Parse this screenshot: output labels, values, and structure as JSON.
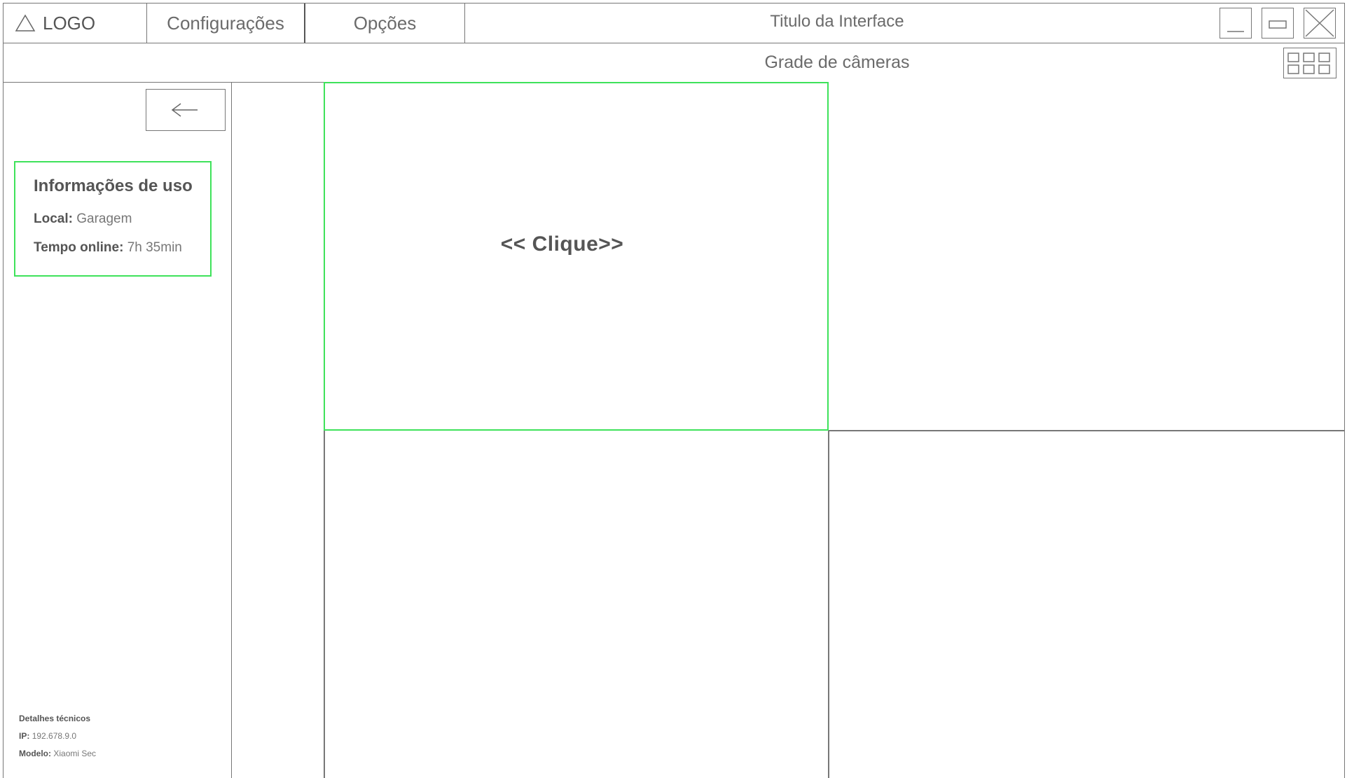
{
  "header": {
    "logo_text": "LOGO",
    "menu": [
      {
        "label": "Configurações"
      },
      {
        "label": "Opções"
      }
    ],
    "window_title": "Titulo da Interface"
  },
  "subheader": {
    "title": "Grade de câmeras"
  },
  "sidebar": {
    "back_label": "<—",
    "info": {
      "title": "Informações de uso",
      "local_label": "Local:",
      "local_value": "Garagem",
      "tempo_label": "Tempo online:",
      "tempo_value": "7h 35min"
    },
    "tech": {
      "title": "Detalhes técnicos",
      "ip_label": "IP:",
      "ip_value": "192.678.9.0",
      "modelo_label": "Modelo:",
      "modelo_value": "Xiaomi Sec"
    }
  },
  "cameras": [
    {
      "label": "<< Clique>>",
      "selected": true
    },
    {
      "label": "",
      "selected": false
    },
    {
      "label": "",
      "selected": false
    },
    {
      "label": "",
      "selected": false
    }
  ],
  "colors": {
    "accent_selected": "#3ee25a",
    "border": "#777777",
    "text": "#666666"
  },
  "icons": {
    "logo": "triangle-icon",
    "minimize": "minimize-icon",
    "maximize": "maximize-icon",
    "close": "close-icon",
    "grid": "grid-layout-icon",
    "back": "arrow-left-icon"
  }
}
